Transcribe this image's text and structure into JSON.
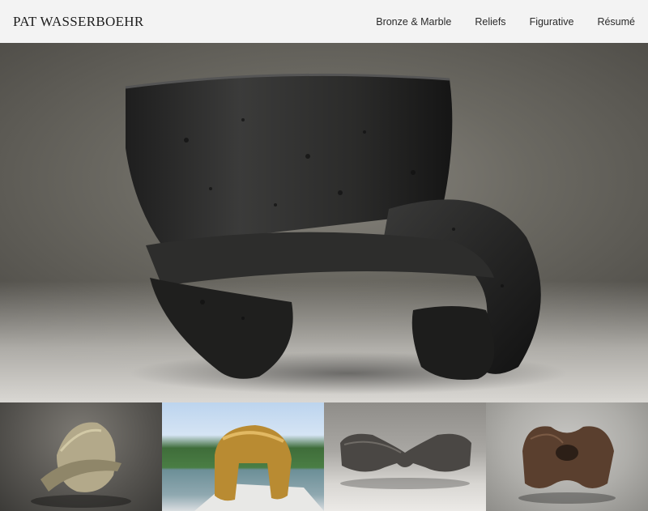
{
  "header": {
    "logo": "PAT WASSERBOEHR",
    "nav": [
      {
        "label": "Bronze & Marble"
      },
      {
        "label": "Reliefs"
      },
      {
        "label": "Figurative"
      },
      {
        "label": "Résumé"
      }
    ]
  },
  "hero": {
    "image": "black-bronze-sculpture-photo"
  },
  "thumbnails": [
    {
      "image": "gold-bronze-disc-sculpture-photo"
    },
    {
      "image": "bronze-helmet-sculpture-by-lake-photo"
    },
    {
      "image": "dark-bronze-bowtie-sculpture-photo"
    },
    {
      "image": "dark-bronze-knot-sculpture-photo"
    }
  ]
}
